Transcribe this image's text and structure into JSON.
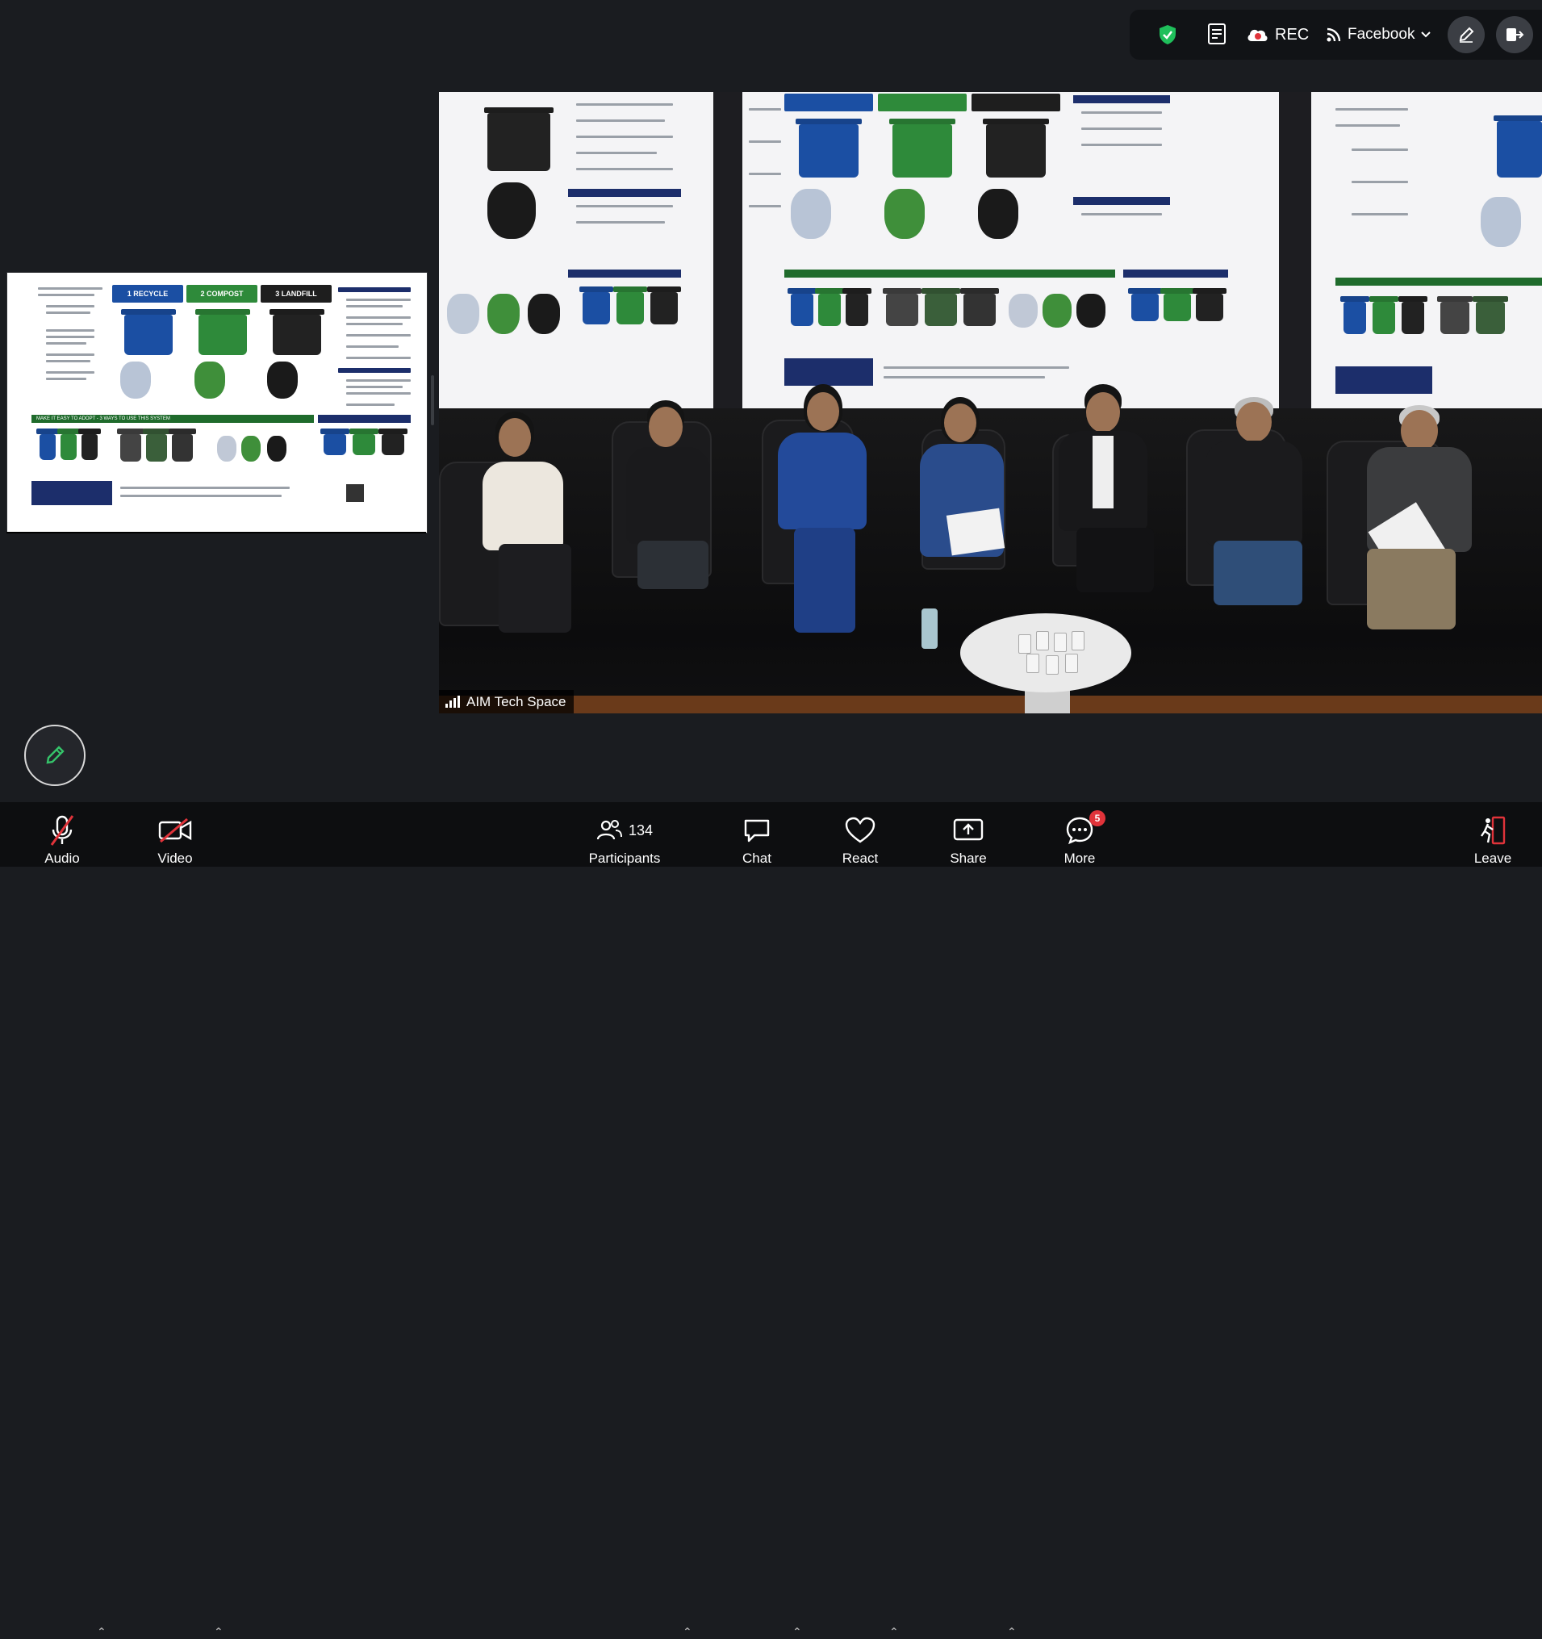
{
  "top_bar": {
    "rec_label": "REC",
    "stream_label": "Facebook",
    "icons": [
      "shield-icon",
      "captions-icon",
      "cloud-icon",
      "rss-icon",
      "chevron-down-icon",
      "pencil-icon",
      "share-screen-icon"
    ]
  },
  "main_video": {
    "speaker_label": "AIM Tech Space"
  },
  "poster": {
    "header_recycle": "1 RECYCLE",
    "header_compost": "2 COMPOST",
    "header_landfill": "3 LANDFILL",
    "bin_recycle": "RECYCLE",
    "bin_compost": "COMPOST",
    "bin_landfill": "LANDFILL",
    "band_adopt": "MAKE IT EASY TO ADOPT - 3 WAYS TO USE THIS SYSTEM"
  },
  "toolbar": {
    "audio_label": "Audio",
    "video_label": "Video",
    "participants_label": "Participants",
    "participants_count": "134",
    "chat_label": "Chat",
    "react_label": "React",
    "share_label": "Share",
    "more_label": "More",
    "more_badge": "5",
    "leave_label": "Leave"
  },
  "colors": {
    "recycle_blue": "#1b4fa3",
    "compost_green": "#2e8a3a",
    "landfill_black": "#1e1e1e",
    "badge_red": "#e0333a",
    "shield_green": "#1fbf5b"
  }
}
